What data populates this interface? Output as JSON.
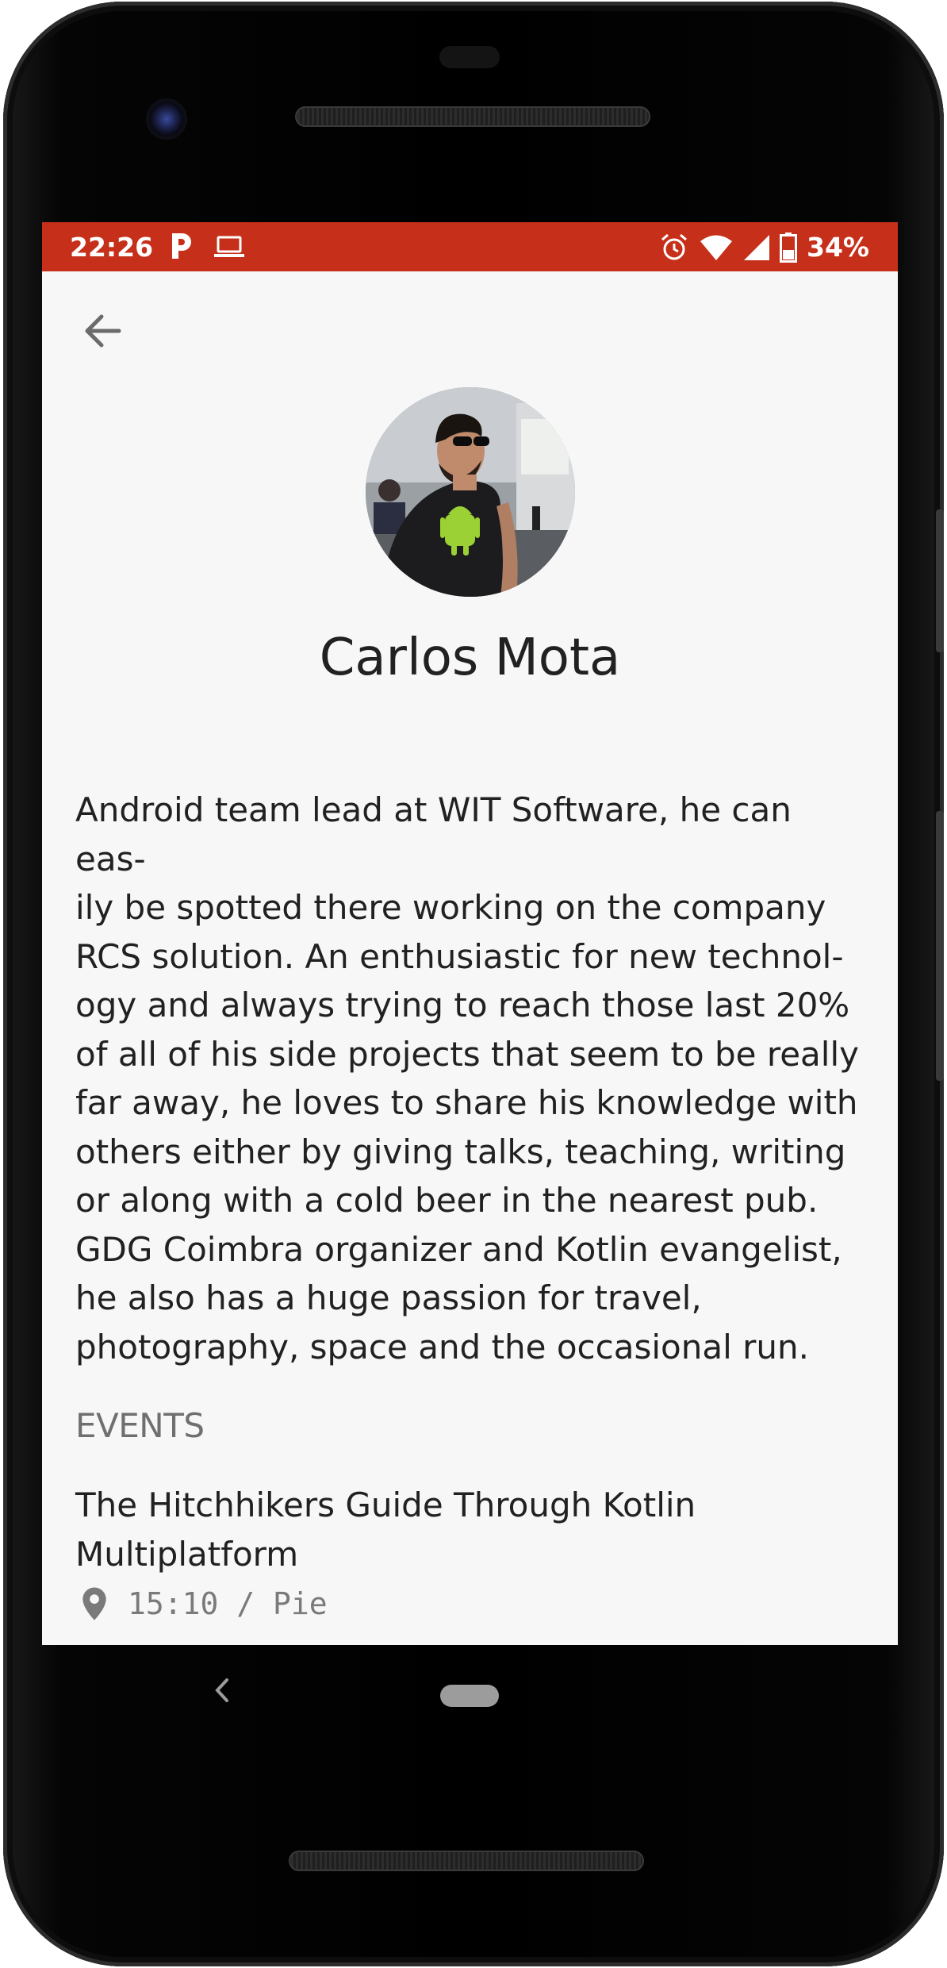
{
  "status_bar": {
    "time": "22:26",
    "battery_percent": "34%",
    "color": "#c62f19",
    "icons": [
      "parking-icon",
      "laptop-icon",
      "alarm-icon",
      "wifi-icon",
      "cell-signal-icon",
      "battery-icon"
    ]
  },
  "toolbar": {
    "back_icon": "arrow-left-icon"
  },
  "speaker": {
    "name": "Carlos Mota",
    "bio_lines": [
      "Android team lead at WIT Software, he can eas-",
      "ily be spotted there working on the company",
      "RCS solution. An enthusiastic for new technol-",
      "ogy and always trying to reach those last 20%",
      "of all of his side projects that seem to be really",
      "far away, he loves to share his knowledge with",
      "others either by giving talks, teaching, writing",
      "or along with a cold beer in the nearest pub.",
      "GDG Coimbra organizer and Kotlin evangelist,",
      "he also has a huge passion for travel,",
      "photography, space and the occasional run."
    ]
  },
  "events": {
    "header": "EVENTS",
    "items": [
      {
        "title_lines": [
          "The Hitchhikers Guide Through Kotlin",
          "Multiplatform"
        ],
        "time_location": "15:10 / Pie",
        "icon": "location-pin-icon"
      }
    ]
  },
  "nav_bar": {
    "icons": [
      "nav-back-icon",
      "nav-home-pill"
    ]
  }
}
